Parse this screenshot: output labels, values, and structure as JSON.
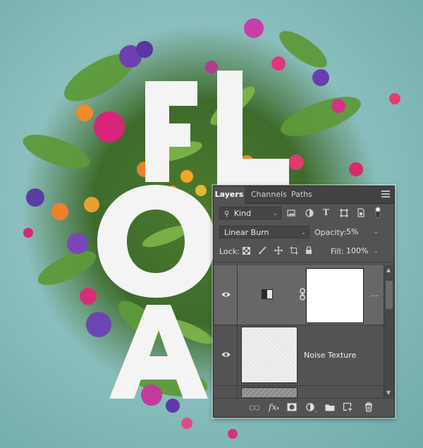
{
  "artwork": {
    "letters": [
      "F",
      "L",
      "O",
      "A"
    ]
  },
  "layers_panel": {
    "tabs": [
      {
        "label": "Layers",
        "active": true
      },
      {
        "label": "Channels",
        "active": false
      },
      {
        "label": "Paths",
        "active": false
      }
    ],
    "filter": {
      "label": "Kind"
    },
    "filter_icons": [
      "image-filter-icon",
      "adjustment-filter-icon",
      "type-filter-icon",
      "shape-filter-icon",
      "smart-object-filter-icon",
      "filter-toggle-icon"
    ],
    "blend_mode": "Linear Burn",
    "opacity_label": "Opacity:",
    "opacity_value": "5%",
    "lock_label": "Lock:",
    "lock_icons": [
      "lock-transparent-icon",
      "lock-paint-icon",
      "lock-position-icon",
      "lock-artboard-icon",
      "lock-all-icon"
    ],
    "fill_label": "Fill:",
    "fill_value": "100%",
    "layers": [
      {
        "name": "",
        "type": "adjustment",
        "visible": true,
        "has_mask": true
      },
      {
        "name": "Noise Texture",
        "type": "pixel",
        "visible": true
      },
      {
        "name": "",
        "type": "pixel",
        "visible": true,
        "partial": true
      }
    ],
    "footer_icons": [
      "link-layers-icon",
      "fx-icon",
      "add-mask-icon",
      "new-adjustment-icon",
      "new-group-icon",
      "new-layer-icon",
      "delete-layer-icon"
    ],
    "fx_label": "fx",
    "colors": {
      "panel": "#535353",
      "tab_bar": "#424242",
      "selected_row": "#676767"
    }
  }
}
